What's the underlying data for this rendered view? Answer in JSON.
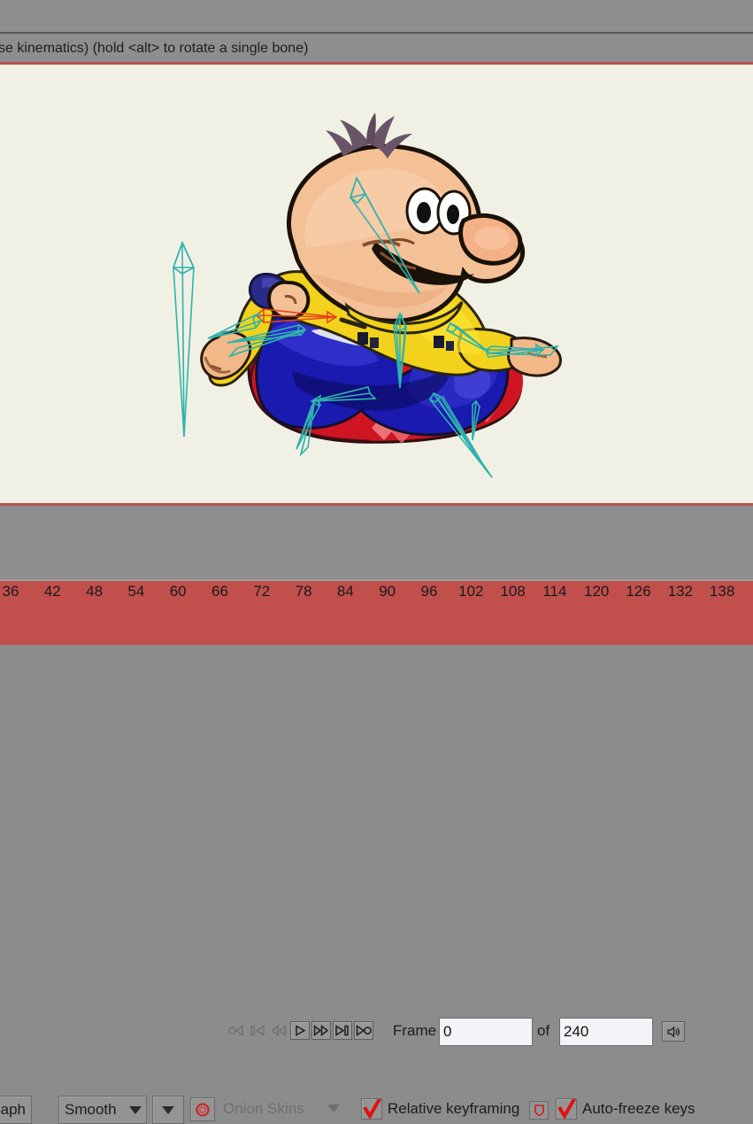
{
  "hint_bar": {
    "text": "se kinematics) (hold <alt> to rotate a single bone)"
  },
  "playback": {
    "buttons": [
      {
        "name": "rewind-to-start-button",
        "icon": "circle-left-triangle-icon",
        "enabled": false,
        "boxed": false
      },
      {
        "name": "previous-keyframe-button",
        "icon": "bar-left-triangle-icon",
        "enabled": false,
        "boxed": false
      },
      {
        "name": "step-back-button",
        "icon": "double-left-triangle-icon",
        "enabled": false,
        "boxed": false
      },
      {
        "name": "play-button",
        "icon": "play-icon",
        "enabled": true,
        "boxed": true
      },
      {
        "name": "fast-forward-button",
        "icon": "double-right-triangle-icon",
        "enabled": true,
        "boxed": true
      },
      {
        "name": "next-keyframe-button",
        "icon": "triangle-right-bar-icon",
        "enabled": true,
        "boxed": true
      },
      {
        "name": "go-to-end-button",
        "icon": "triangle-right-circle-icon",
        "enabled": true,
        "boxed": true
      }
    ],
    "frame_label": "Frame",
    "frame_value": "0",
    "of_label": "of",
    "total_value": "240",
    "sound_button": {
      "name": "sound-toggle-button",
      "icon": "speaker-icon"
    }
  },
  "options": {
    "graph_button": "aph",
    "interpolation": "Smooth",
    "onion_skins_label": "Onion Skins",
    "relative_keyframing_label": "Relative keyframing",
    "relative_keyframing_checked": true,
    "auto_freeze_label": "Auto-freeze keys",
    "auto_freeze_checked": true,
    "shield_icon": "shield-icon",
    "onion_toggle_icon": "red-circle-icon"
  },
  "timeline": {
    "ticks": [
      36,
      42,
      48,
      54,
      60,
      66,
      72,
      78,
      84,
      90,
      96,
      102,
      108,
      114,
      120,
      126,
      132,
      138
    ]
  },
  "colors": {
    "toolbar_gray": "#8e8e8e",
    "canvas_cream": "#f1f0e4",
    "accent_red": "#b8514e",
    "timeline_red": "#c1504d",
    "bone_teal": "#2fb3ae",
    "bone_selected": "#e8441a"
  },
  "canvas": {
    "description": "cartoon-character-with-bone-rig"
  }
}
